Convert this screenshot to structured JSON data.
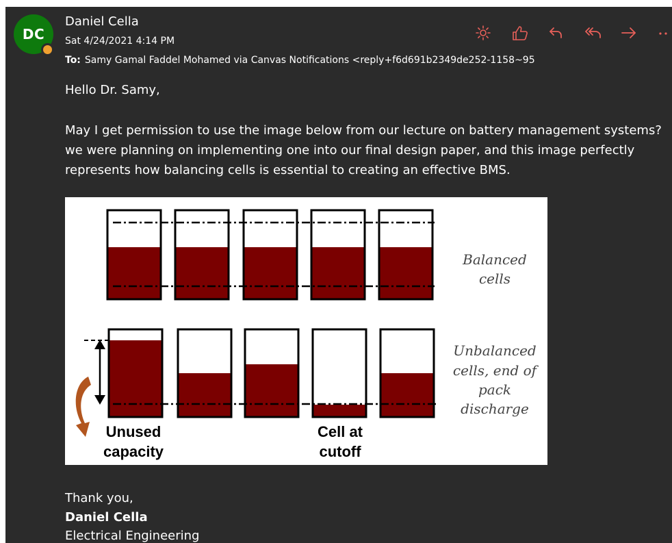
{
  "email": {
    "avatar_initials": "DC",
    "sender_name": "Daniel Cella",
    "date": "Sat 4/24/2021 4:14 PM",
    "to_label": "To:",
    "to_value": "Samy Gamal Faddel Mohamed via Canvas Notifications <reply+f6d691b2349de252-1158~95",
    "greeting": "Hello Dr. Samy,",
    "paragraph": "May I get permission to use the image below from our lecture on battery management systems? we were planning on implementing one into our final design paper, and this image perfectly represents how balancing cells is essential to creating an effective BMS.",
    "sign_off": "Thank you,",
    "signature_name": "Daniel Cella",
    "signature_title": "Electrical Engineering"
  },
  "toolbar": {
    "icons": [
      "sun-icon",
      "like-icon",
      "reply-icon",
      "reply-all-icon",
      "forward-icon",
      "more-icon"
    ],
    "icon_color": "#e8605a"
  },
  "figure": {
    "balanced_label_line1": "Balanced",
    "balanced_label_line2": "cells",
    "unbalanced_label_line1": "Unbalanced",
    "unbalanced_label_line2": "cells, end of",
    "unbalanced_label_line3": "pack",
    "unbalanced_label_line4": "discharge",
    "unused_line1": "Unused",
    "unused_line2": "capacity",
    "cutoff_line1": "Cell at",
    "cutoff_line2": "cutoff",
    "cell_fill_color": "#7a0000",
    "arrow_color": "#b2561f"
  },
  "theme": {
    "background": "#2b2b2b",
    "avatar_color": "#0e7a0d"
  }
}
